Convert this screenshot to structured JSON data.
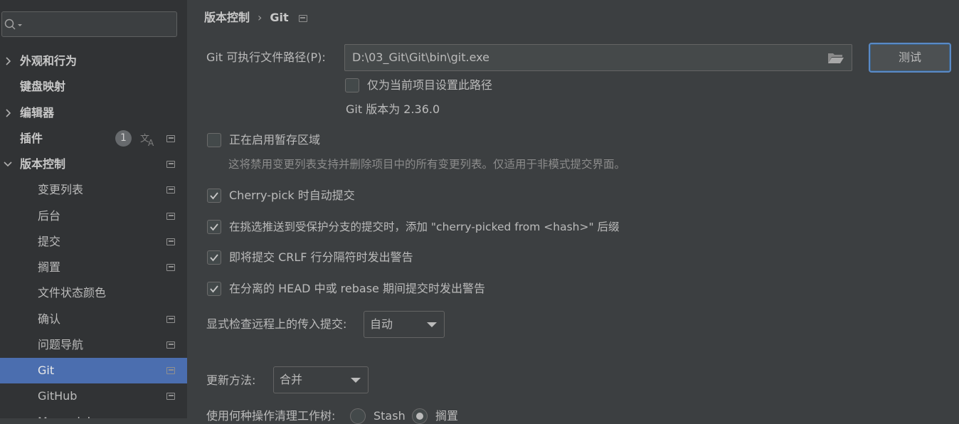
{
  "sidebar": {
    "search": {
      "placeholder": ""
    },
    "items": [
      {
        "label": "外观和行为"
      },
      {
        "label": "键盘映射"
      },
      {
        "label": "编辑器"
      },
      {
        "label": "插件",
        "badge": "1"
      },
      {
        "label": "版本控制"
      },
      {
        "label": "变更列表"
      },
      {
        "label": "后台"
      },
      {
        "label": "提交"
      },
      {
        "label": "搁置"
      },
      {
        "label": "文件状态颜色"
      },
      {
        "label": "确认"
      },
      {
        "label": "问题导航"
      },
      {
        "label": "Git"
      },
      {
        "label": "GitHub"
      },
      {
        "label": "Mercurial"
      }
    ]
  },
  "breadcrumb": {
    "parent": "版本控制",
    "separator": "›",
    "current": "Git"
  },
  "git_path": {
    "label": "Git 可执行文件路径(P):",
    "value": "D:\\03_Git\\Git\\bin\\git.exe",
    "test_button": "测试",
    "project_only": {
      "label": "仅为当前项目设置此路径",
      "checked": false
    },
    "version": "Git 版本为 2.36.0"
  },
  "options": {
    "staging_area": {
      "label": "正在启用暂存区域",
      "checked": false,
      "hint": "这将禁用变更列表支持并删除项目中的所有变更列表。仅适用于非模式提交界面。"
    },
    "cherry_pick_commit": {
      "label": "Cherry-pick 时自动提交",
      "checked": true
    },
    "cherry_picked_suffix": {
      "label": "在挑选推送到受保护分支的提交时，添加 \"cherry-picked from <hash>\" 后缀",
      "checked": true
    },
    "crlf_warning": {
      "label": "即将提交 CRLF 行分隔符时发出警告",
      "checked": true
    },
    "detached_head_warning": {
      "label": "在分离的 HEAD 中或 rebase 期间提交时发出警告",
      "checked": true
    }
  },
  "incoming_check": {
    "label": "显式检查远程上的传入提交:",
    "value": "自动"
  },
  "update_method": {
    "label": "更新方法:",
    "value": "合并"
  },
  "cleanup": {
    "label": "使用何种操作清理工作树:",
    "option_stash": "Stash",
    "option_shelve": "搁置",
    "selected": "搁置"
  },
  "colors": {
    "background": "#3c3f41",
    "sidebar": "#313335",
    "selection": "#4b6eaf",
    "accent_border": "#5a8ac6"
  }
}
